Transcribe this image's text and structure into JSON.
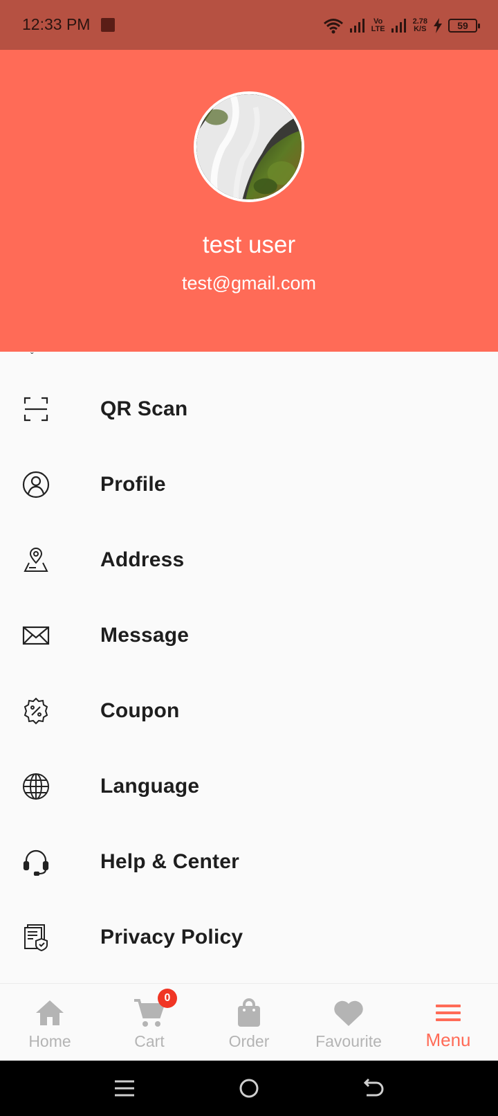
{
  "status_bar": {
    "time": "12:33 PM",
    "volte_top": "Vo",
    "volte_bottom": "LTE",
    "speed_value": "2.78",
    "speed_unit": "K/S",
    "battery": "59"
  },
  "header": {
    "background_color": "#ff6b57",
    "user_name": "test user",
    "user_email": "test@gmail.com"
  },
  "menu": {
    "items": [
      {
        "icon": "qr-scan-icon",
        "label": "QR Scan"
      },
      {
        "icon": "profile-icon",
        "label": "Profile"
      },
      {
        "icon": "map-pin-icon",
        "label": "Address"
      },
      {
        "icon": "envelope-icon",
        "label": "Message"
      },
      {
        "icon": "coupon-icon",
        "label": "Coupon"
      },
      {
        "icon": "globe-icon",
        "label": "Language"
      },
      {
        "icon": "headset-icon",
        "label": "Help & Center"
      },
      {
        "icon": "privacy-doc-icon",
        "label": "Privacy Policy"
      }
    ]
  },
  "bottom_nav": {
    "items": [
      {
        "icon": "home-icon",
        "label": "Home"
      },
      {
        "icon": "cart-icon",
        "label": "Cart",
        "badge": "0"
      },
      {
        "icon": "shopping-bag-icon",
        "label": "Order"
      },
      {
        "icon": "heart-icon",
        "label": "Favourite"
      },
      {
        "icon": "hamburger-menu-icon",
        "label": "Menu",
        "active": true
      }
    ],
    "active_color": "#ff6b57",
    "inactive_color": "#b4b4b4"
  },
  "system_nav": {
    "buttons": [
      "recent-apps-icon",
      "home-circle-icon",
      "back-icon"
    ]
  }
}
